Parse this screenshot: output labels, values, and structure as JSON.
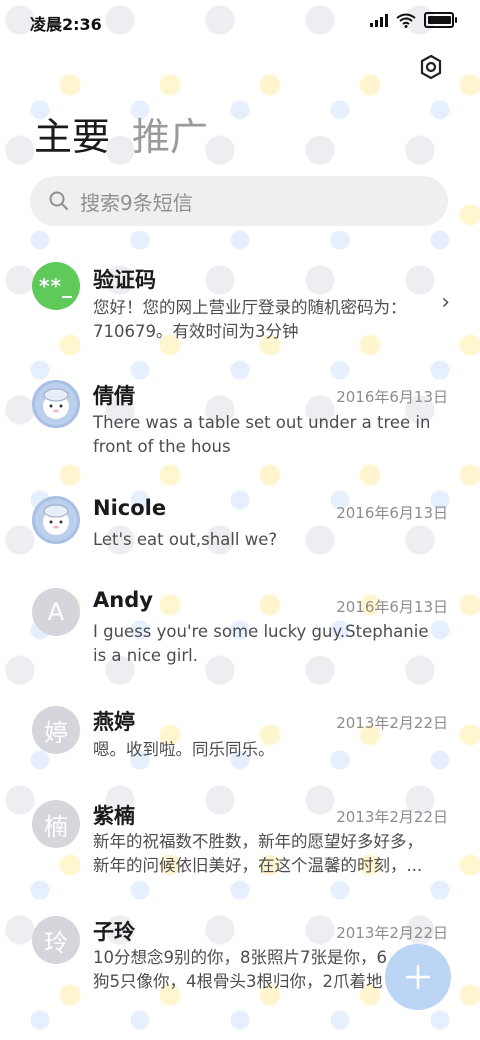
{
  "status": {
    "time": "凌晨2:36"
  },
  "header": {
    "tabs": [
      {
        "label": "主要",
        "active": true
      },
      {
        "label": "推广",
        "active": false
      }
    ]
  },
  "search": {
    "placeholder": "搜索9条短信"
  },
  "conversations": [
    {
      "name": "验证码",
      "avatar_text": "**_",
      "date": "",
      "message": "您好！您的网上营业厅登录的随机密码为：710679。有效时间为3分钟",
      "message_lines": [
        "您好！您的网上营业厅登录的随机密码为：",
        "710679。有效时间为3分钟"
      ]
    },
    {
      "name": "倩倩",
      "avatar_text": "",
      "date": "2016年6月13日",
      "message_lines": [
        "There was a table set out under a tree in",
        "front of the hous"
      ]
    },
    {
      "name": "Nicole",
      "avatar_text": "",
      "date": "2016年6月13日",
      "message_lines": [
        "Let's eat out,shall we?"
      ]
    },
    {
      "name": "Andy",
      "avatar_text": "A",
      "date": "2016年6月13日",
      "message_lines": [
        "I guess you're some lucky guy.Stephanie",
        "is a nice girl."
      ]
    },
    {
      "name": "燕婷",
      "avatar_text": "婷",
      "date": "2013年2月22日",
      "message_lines": [
        "嗯。收到啦。同乐同乐。"
      ]
    },
    {
      "name": "紫楠",
      "avatar_text": "楠",
      "date": "2013年2月22日",
      "message_lines": [
        "新年的祝福数不胜数，新年的愿望好多好多，",
        "新年的问候依旧美好，在这个温馨的时刻，..."
      ]
    },
    {
      "name": "子玲",
      "avatar_text": "玲",
      "date": "2013年2月22日",
      "message_lines": [
        "10分想念9别的你，8张照片7张是你，6",
        "狗5只像你，4根骨头3根归你，2爪着地"
      ]
    }
  ],
  "colors": {
    "accent_green": "#5fc95a",
    "fab": "#b0cef2"
  },
  "icons": {
    "settings": "gear-icon",
    "search": "search-icon",
    "compose": "plus-icon"
  }
}
